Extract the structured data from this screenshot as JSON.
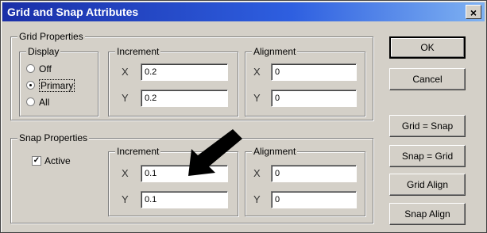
{
  "window": {
    "title": "Grid and Snap Attributes",
    "close_label": "×"
  },
  "grid_properties": {
    "label": "Grid Properties",
    "display": {
      "label": "Display",
      "options": [
        {
          "label": "Off",
          "checked": false
        },
        {
          "label": "Primary",
          "checked": true
        },
        {
          "label": "All",
          "checked": false
        }
      ]
    },
    "increment": {
      "label": "Increment",
      "x_label": "X",
      "y_label": "Y",
      "x_value": "0.2",
      "y_value": "0.2"
    },
    "alignment": {
      "label": "Alignment",
      "x_label": "X",
      "y_label": "Y",
      "x_value": "0",
      "y_value": "0"
    }
  },
  "snap_properties": {
    "label": "Snap Properties",
    "active": {
      "label": "Active",
      "checked": true,
      "mark": "✓"
    },
    "increment": {
      "label": "Increment",
      "x_label": "X",
      "y_label": "Y",
      "x_value": "0.1",
      "y_value": "0.1"
    },
    "alignment": {
      "label": "Alignment",
      "x_label": "X",
      "y_label": "Y",
      "x_value": "0",
      "y_value": "0"
    }
  },
  "buttons": {
    "ok": "OK",
    "cancel": "Cancel",
    "grid_equals_snap": "Grid = Snap",
    "snap_equals_grid": "Snap = Grid",
    "grid_align": "Grid Align",
    "snap_align": "Snap Align"
  },
  "annotation": {
    "icon": "arrow-pointer-icon",
    "color": "#000000"
  }
}
